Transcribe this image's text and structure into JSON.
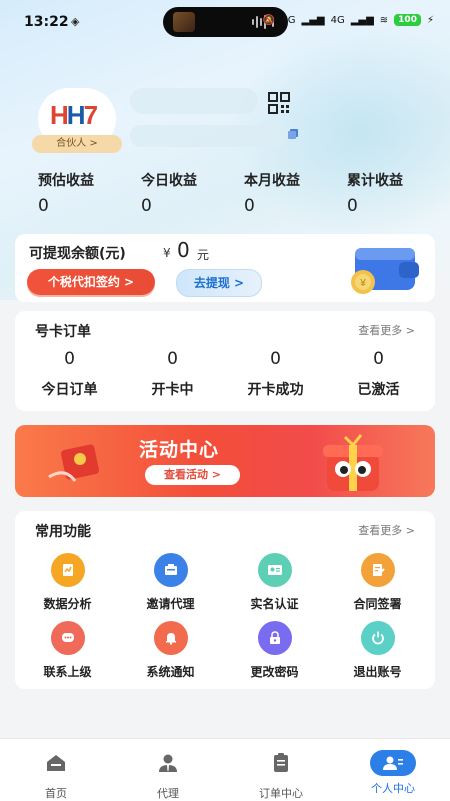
{
  "status_bar": {
    "time": "13:22",
    "battery": "100",
    "network_a": "4G",
    "network_b": "4G"
  },
  "profile": {
    "badge": "合伙人 >",
    "logo_text": "HH"
  },
  "earnings": [
    {
      "label": "预估收益",
      "value": "0"
    },
    {
      "label": "今日收益",
      "value": "0"
    },
    {
      "label": "本月收益",
      "value": "0"
    },
    {
      "label": "累计收益",
      "value": "0"
    }
  ],
  "balance": {
    "label": "可提现余额(元)",
    "currency": "¥",
    "value": "0",
    "unit": "元",
    "sign_button": "个税代扣签约 >",
    "withdraw_button": "去提现 >"
  },
  "orders": {
    "title": "号卡订单",
    "see_more": "查看更多 >",
    "stats": [
      {
        "value": "0",
        "label": "今日订单"
      },
      {
        "value": "0",
        "label": "开卡中"
      },
      {
        "value": "0",
        "label": "开卡成功"
      },
      {
        "value": "0",
        "label": "已激活"
      }
    ]
  },
  "banner": {
    "title": "活动中心",
    "button": "查看活动 >"
  },
  "features": {
    "title": "常用功能",
    "see_more": "查看更多 >",
    "items": [
      {
        "label": "数据分析",
        "icon": "data-analysis-icon",
        "color": "#f5a623"
      },
      {
        "label": "邀请代理",
        "icon": "invite-agent-icon",
        "color": "#3b82e8"
      },
      {
        "label": "实名认证",
        "icon": "real-name-icon",
        "color": "#5ccfb4"
      },
      {
        "label": "合同签署",
        "icon": "contract-icon",
        "color": "#f3a23a"
      },
      {
        "label": "联系上级",
        "icon": "chat-icon",
        "color": "#f06a5a"
      },
      {
        "label": "系统通知",
        "icon": "bell-icon",
        "color": "#f26b4f"
      },
      {
        "label": "更改密码",
        "icon": "lock-icon",
        "color": "#7a6cf0"
      },
      {
        "label": "退出账号",
        "icon": "power-icon",
        "color": "#5bd0c6"
      }
    ]
  },
  "nav": [
    {
      "label": "首页",
      "icon": "home-icon"
    },
    {
      "label": "代理",
      "icon": "agent-icon"
    },
    {
      "label": "订单中心",
      "icon": "order-center-icon"
    },
    {
      "label": "个人中心",
      "icon": "profile-icon",
      "active": true
    }
  ],
  "colors": {
    "accent": "#1d73e8",
    "danger": "#f0533a"
  }
}
